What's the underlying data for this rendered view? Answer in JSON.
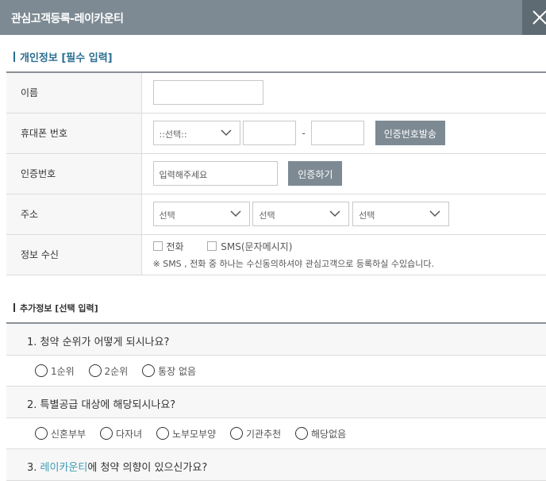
{
  "window": {
    "title": "관심고객등록-레이카운티",
    "close_icon": "close-icon"
  },
  "personal": {
    "heading": "개인정보 [필수 입력]",
    "rows": {
      "name": {
        "label": "이름",
        "value": ""
      },
      "phone": {
        "label": "휴대폰 번호",
        "prefix_selected": "::선택::",
        "separator": "-",
        "send_button": "인증번호발송"
      },
      "auth": {
        "label": "인증번호",
        "placeholder": "입력해주세요",
        "verify_button": "인증하기"
      },
      "address": {
        "label": "주소",
        "select1": "선택",
        "select2": "선택",
        "select3": "선택"
      },
      "consent": {
        "label": "정보 수신",
        "option_phone": "전화",
        "option_sms": "SMS(문자메시지)",
        "note": "※ SMS , 전화 중 하나는 수신동의하셔야 관심고객으로 등록하실 수있습니다."
      }
    }
  },
  "extra": {
    "heading": "추가정보 [선택 입력]",
    "q1": {
      "question": "1. 청약 순위가 어떻게 되시나요?",
      "options": [
        "1순위",
        "2순위",
        "통장 없음"
      ]
    },
    "q2": {
      "question": "2. 특별공급 대상에 해당되시나요?",
      "options": [
        "신혼부부",
        "다자녀",
        "노부모부양",
        "기관추천",
        "해당없음"
      ]
    },
    "q3": {
      "prefix": "3. ",
      "highlight": "레이카운티",
      "suffix": "에 청약 의향이 있으신가요?"
    }
  },
  "colors": {
    "titlebar": "#7d8a93",
    "accent": "#2a6e90",
    "highlight": "#3a9bb5",
    "button": "#7d8a93"
  }
}
